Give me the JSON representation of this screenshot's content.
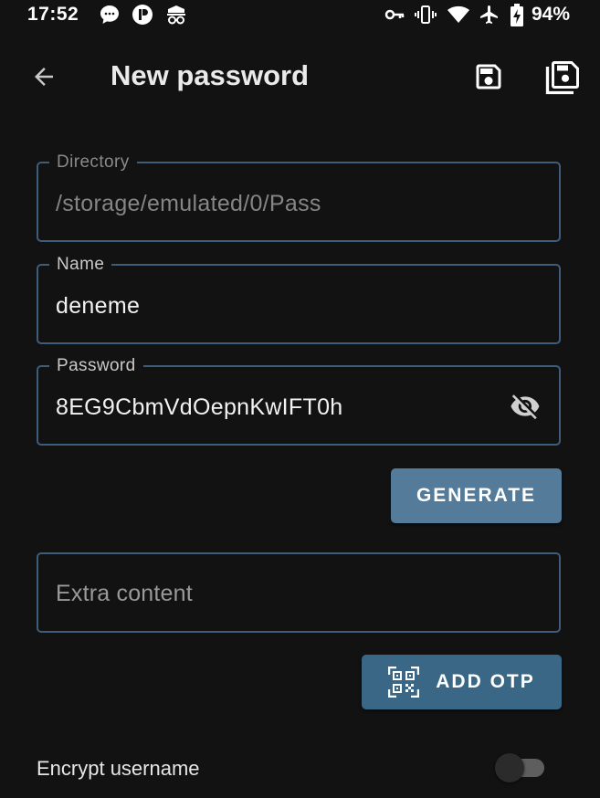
{
  "status_bar": {
    "time": "17:52",
    "left_icons": [
      "chat-notification-icon",
      "app-notification-icon",
      "stealth-mode-icon"
    ],
    "right_icons": [
      "vpn-key-icon",
      "vibrate-icon",
      "wifi-icon",
      "airplane-icon",
      "battery-charging-icon"
    ],
    "battery_percent": "94%"
  },
  "app_bar": {
    "back_icon": "arrow-back-icon",
    "title": "New password",
    "save_icon": "save-icon",
    "save_copy_icon": "save-copy-icon"
  },
  "form": {
    "directory": {
      "label": "Directory",
      "value": "/storage/emulated/0/Pass",
      "enabled": false
    },
    "name": {
      "label": "Name",
      "value": "deneme"
    },
    "password": {
      "label": "Password",
      "value": "8EG9CbmVdOepnKwIFT0h",
      "visibility_icon": "visibility-off-icon"
    },
    "generate_button": "GENERATE",
    "extra_content": {
      "placeholder": "Extra content",
      "value": ""
    },
    "add_otp_button": {
      "label": "ADD OTP",
      "icon": "qr-code-scan-icon"
    },
    "encrypt_username": {
      "label": "Encrypt username",
      "checked": false
    }
  },
  "colors": {
    "background": "#121212",
    "field_border": "#3d5d7b",
    "generate_button": "#557b9a",
    "add_otp_button": "#3b6787"
  }
}
